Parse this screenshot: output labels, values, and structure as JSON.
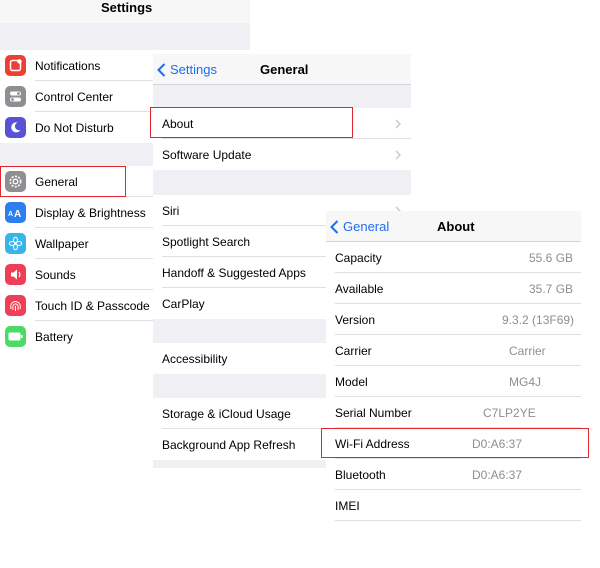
{
  "settings_panel": {
    "title": "Settings",
    "groups": [
      {
        "items": [
          {
            "label": "Notifications",
            "icon": "notifications-icon",
            "color": "#ef3e36"
          },
          {
            "label": "Control Center",
            "icon": "control-center-icon",
            "color": "#8e8e93"
          },
          {
            "label": "Do Not Disturb",
            "icon": "moon-icon",
            "color": "#5a52d6"
          }
        ]
      },
      {
        "items": [
          {
            "label": "General",
            "icon": "gear-icon",
            "color": "#8e8e93"
          },
          {
            "label": "Display & Brightness",
            "icon": "display-brightness-icon",
            "color": "#2d7ff0"
          },
          {
            "label": "Wallpaper",
            "icon": "wallpaper-icon",
            "color": "#39b4e8"
          },
          {
            "label": "Sounds",
            "icon": "speaker-icon",
            "color": "#ef3e56"
          },
          {
            "label": "Touch ID & Passcode",
            "icon": "fingerprint-icon",
            "color": "#ef3e56"
          },
          {
            "label": "Battery",
            "icon": "battery-icon",
            "color": "#4cd964"
          }
        ]
      }
    ]
  },
  "general_panel": {
    "back_label": "Settings",
    "title": "General",
    "items": [
      "About",
      "Software Update",
      "Siri",
      "Spotlight Search",
      "Handoff & Suggested Apps",
      "CarPlay",
      "Accessibility",
      "Storage & iCloud Usage",
      "Background App Refresh"
    ]
  },
  "about_panel": {
    "back_label": "General",
    "title": "About",
    "rows": [
      {
        "label": "Capacity",
        "value": "55.6 GB"
      },
      {
        "label": "Available",
        "value": "35.7 GB"
      },
      {
        "label": "Version",
        "value": "9.3.2 (13F69)"
      },
      {
        "label": "Carrier",
        "value": "Carrier"
      },
      {
        "label": "Model",
        "value": "MG4J"
      },
      {
        "label": "Serial Number",
        "value": "C7LP2YE"
      },
      {
        "label": "Wi-Fi Address",
        "value": "D0:A6:37"
      },
      {
        "label": "Bluetooth",
        "value": "D0:A6:37"
      },
      {
        "label": "IMEI",
        "value": ""
      }
    ]
  },
  "highlight_color": "#e2262d",
  "accent_color": "#1b6ef3"
}
